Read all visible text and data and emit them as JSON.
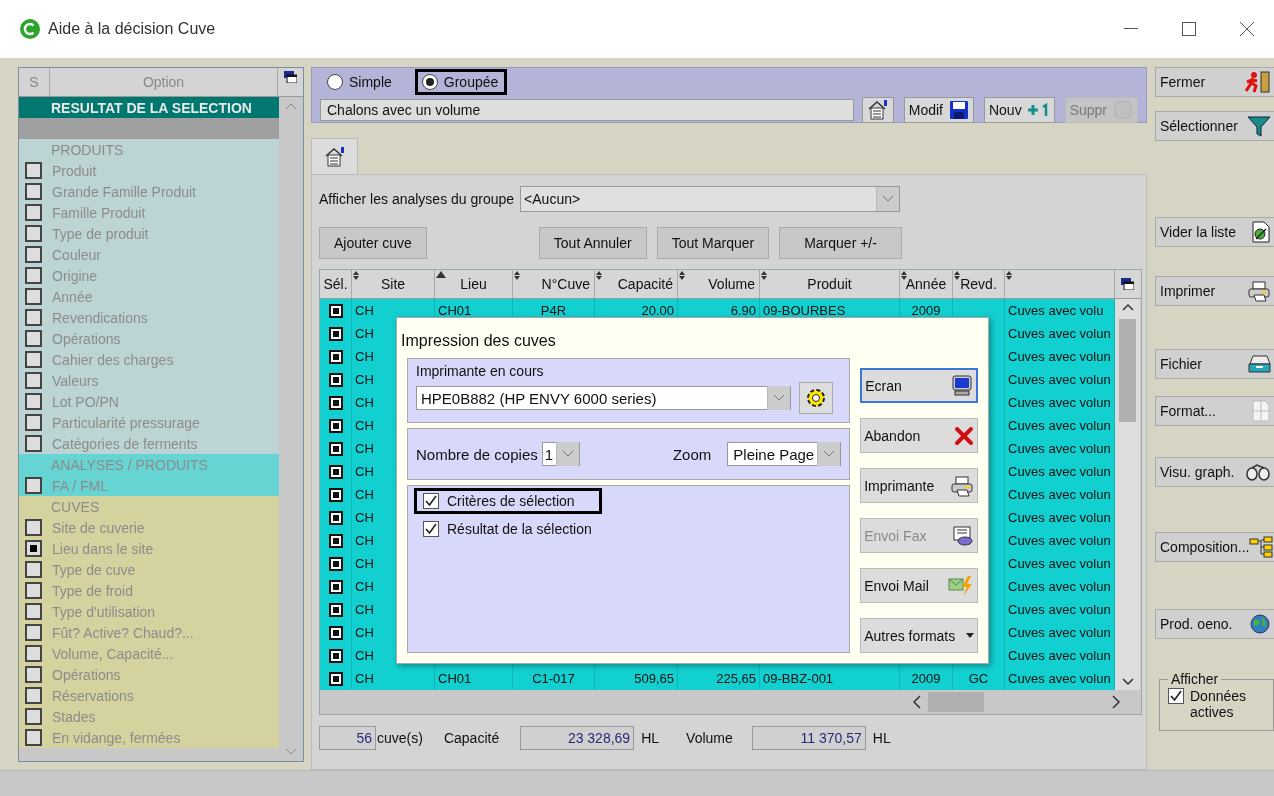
{
  "window": {
    "title": "Aide à la décision Cuve"
  },
  "options_panel": {
    "header_s": "S",
    "header_option": "Option",
    "title": "RESULTAT DE LA SELECTION",
    "groups": [
      {
        "label": "PRODUITS",
        "color": "#bcd4d4",
        "items": [
          {
            "label": "Produit",
            "checked": false
          },
          {
            "label": "Grande Famille Produit",
            "checked": false
          },
          {
            "label": "Famille Produit",
            "checked": false
          },
          {
            "label": "Type de produit",
            "checked": false
          },
          {
            "label": "Couleur",
            "checked": false
          },
          {
            "label": "Origine",
            "checked": false
          },
          {
            "label": "Année",
            "checked": false
          },
          {
            "label": "Revendications",
            "checked": false
          },
          {
            "label": "Opérations",
            "checked": false
          },
          {
            "label": "Cahier des charges",
            "checked": false
          },
          {
            "label": "Valeurs",
            "checked": false
          },
          {
            "label": "Lot PO/PN",
            "checked": false
          },
          {
            "label": "Particularité pressurage",
            "checked": false
          },
          {
            "label": "Catégories de ferments",
            "checked": false
          }
        ]
      },
      {
        "label": "ANALYSES / PRODUITS",
        "color": "#66d4d2",
        "items": [
          {
            "label": "FA / FML",
            "checked": false
          }
        ]
      },
      {
        "label": "CUVES",
        "color": "#d4d29e",
        "items": [
          {
            "label": "Site de cuverie",
            "checked": false
          },
          {
            "label": "Lieu dans le site",
            "checked": true
          },
          {
            "label": "Type de cuve",
            "checked": false
          },
          {
            "label": "Type de froid",
            "checked": false
          },
          {
            "label": "Type d'utilisation",
            "checked": false
          },
          {
            "label": "Fût?  Active?  Chaud?...",
            "checked": false
          },
          {
            "label": "Volume, Capacité...",
            "checked": false
          },
          {
            "label": "Opérations",
            "checked": false
          },
          {
            "label": "Réservations",
            "checked": false
          },
          {
            "label": "Stades",
            "checked": false
          },
          {
            "label": "En vidange, fermées",
            "checked": false
          }
        ]
      }
    ]
  },
  "mode": [
    {
      "label": "Simple",
      "selected": false,
      "highlighted": false
    },
    {
      "label": "Groupée",
      "selected": true,
      "highlighted": true
    }
  ],
  "group_name": {
    "value": "Chalons avec un volume"
  },
  "group_buttons": [
    {
      "kind": "list",
      "disabled": false
    },
    {
      "kind": "save",
      "label": "Modif",
      "disabled": false
    },
    {
      "kind": "add",
      "label": "Nouv",
      "disabled": false
    },
    {
      "kind": "delete",
      "label": "Suppr",
      "disabled": true
    }
  ],
  "analyses": {
    "label": "Afficher les analyses du groupe",
    "value": "<Aucun>"
  },
  "actions": [
    "Ajouter cuve",
    "Tout Annuler",
    "Tout Marquer",
    "Marquer +/-"
  ],
  "table": {
    "columns": [
      {
        "label": "Sél.",
        "sorted_ascending": false
      },
      {
        "label": "Site",
        "sorted_ascending": false
      },
      {
        "label": "Lieu",
        "sorted_ascending": true
      },
      {
        "label": "N°Cuve",
        "sorted_ascending": false
      },
      {
        "label": "Capacité",
        "sorted_ascending": false
      },
      {
        "label": "Volume",
        "sorted_ascending": false
      },
      {
        "label": "Produit",
        "sorted_ascending": false
      },
      {
        "label": "Année",
        "sorted_ascending": false
      },
      {
        "label": "Revd.",
        "sorted_ascending": false
      },
      {
        "sorted_ascending": false
      }
    ],
    "rows": [
      {
        "marked": true,
        "cells": {
          "site": "CH",
          "lieu": "CH01",
          "cuve": "P4R",
          "capacite": "20.00",
          "volume": "6.90",
          "produit": "09-BOURBES",
          "annee": "2009",
          "column_10": "Cuves avec volu"
        }
      },
      {
        "marked": true,
        "cells": {
          "site": "CH",
          "column_10": "Cuves avec volun"
        }
      },
      {
        "marked": true,
        "cells": {
          "site": "CH",
          "column_10": "Cuves avec volun"
        }
      },
      {
        "marked": true,
        "cells": {
          "site": "CH",
          "column_10": "Cuves avec volun"
        }
      },
      {
        "marked": true,
        "cells": {
          "site": "CH",
          "column_10": "Cuves avec volun"
        }
      },
      {
        "marked": true,
        "cells": {
          "site": "CH",
          "column_10": "Cuves avec volun"
        }
      },
      {
        "marked": true,
        "cells": {
          "site": "CH",
          "column_10": "Cuves avec volun"
        }
      },
      {
        "marked": true,
        "cells": {
          "site": "CH",
          "column_10": "Cuves avec volun"
        }
      },
      {
        "marked": true,
        "cells": {
          "site": "CH",
          "column_10": "Cuves avec volun"
        }
      },
      {
        "marked": true,
        "cells": {
          "site": "CH",
          "column_10": "Cuves avec volun"
        }
      },
      {
        "marked": true,
        "cells": {
          "site": "CH",
          "column_10": "Cuves avec volun"
        }
      },
      {
        "marked": true,
        "cells": {
          "site": "CH",
          "column_10": "Cuves avec volun"
        }
      },
      {
        "marked": true,
        "cells": {
          "site": "CH",
          "column_10": "Cuves avec volun"
        }
      },
      {
        "marked": true,
        "cells": {
          "site": "CH",
          "column_10": "Cuves avec volun"
        }
      },
      {
        "marked": true,
        "cells": {
          "site": "CH",
          "column_10": "Cuves avec volun"
        }
      },
      {
        "marked": true,
        "cells": {
          "site": "CH",
          "column_10": "Cuves avec volun"
        }
      },
      {
        "marked": true,
        "cells": {
          "site": "CH",
          "lieu": "CH01",
          "cuve": "C1-017",
          "capacite": "509,65",
          "volume": "225,65",
          "produit": "09-BBZ-001",
          "annee": "2009",
          "revd": "GC",
          "column_10": "Cuves avec volun"
        }
      }
    ]
  },
  "totals": {
    "count": "56",
    "count_unit": "cuve(s)",
    "capacity_label": "Capacité",
    "capacity": "23 328,69",
    "capacity_unit": "HL",
    "volume_label": "Volume",
    "volume": "11 370,57",
    "volume_unit": "HL"
  },
  "side_buttons": [
    {
      "kind": "exit",
      "label": "Fermer"
    },
    {
      "kind": "filter",
      "label": "Sélectionner"
    },
    {
      "kind": "clear",
      "label": "Vider la liste"
    },
    {
      "kind": "print",
      "label": "Imprimer"
    },
    {
      "kind": "file",
      "label": "Fichier"
    },
    {
      "kind": "format",
      "label": "Format..."
    },
    {
      "kind": "graph",
      "label": "Visu. graph."
    },
    {
      "kind": "tree",
      "label": "Composition..."
    },
    {
      "kind": "globe",
      "label": "Prod. oeno."
    }
  ],
  "display_box": {
    "legend": "Afficher",
    "option": {
      "label": "Données actives",
      "checked": true
    }
  },
  "print_dialog": {
    "title": "Impression des cuves",
    "printer_label": "Imprimante en cours",
    "printer": "HPE0B882 (HP ENVY 6000 series)",
    "copies_label": "Nombre de copies",
    "copies": "1",
    "zoom_label": "Zoom",
    "zoom": "Pleine Page",
    "options": [
      {
        "label": "Critères de sélection",
        "checked": true,
        "highlighted": true
      },
      {
        "label": "Résultat de la sélection",
        "checked": true,
        "highlighted": false
      }
    ],
    "buttons": [
      {
        "kind": "screen",
        "label": "Ecran",
        "focused": true,
        "disabled": false
      },
      {
        "kind": "cancel",
        "label": "Abandon",
        "focused": false,
        "disabled": false
      },
      {
        "kind": "print",
        "label": "Imprimante",
        "focused": false,
        "disabled": false
      },
      {
        "kind": "fax",
        "label": "Envoi Fax",
        "focused": false,
        "disabled": true
      },
      {
        "kind": "mail",
        "label": "Envoi Mail",
        "focused": false,
        "disabled": false
      },
      {
        "kind": "menu",
        "label": "Autres formats",
        "focused": false,
        "disabled": false
      }
    ]
  }
}
